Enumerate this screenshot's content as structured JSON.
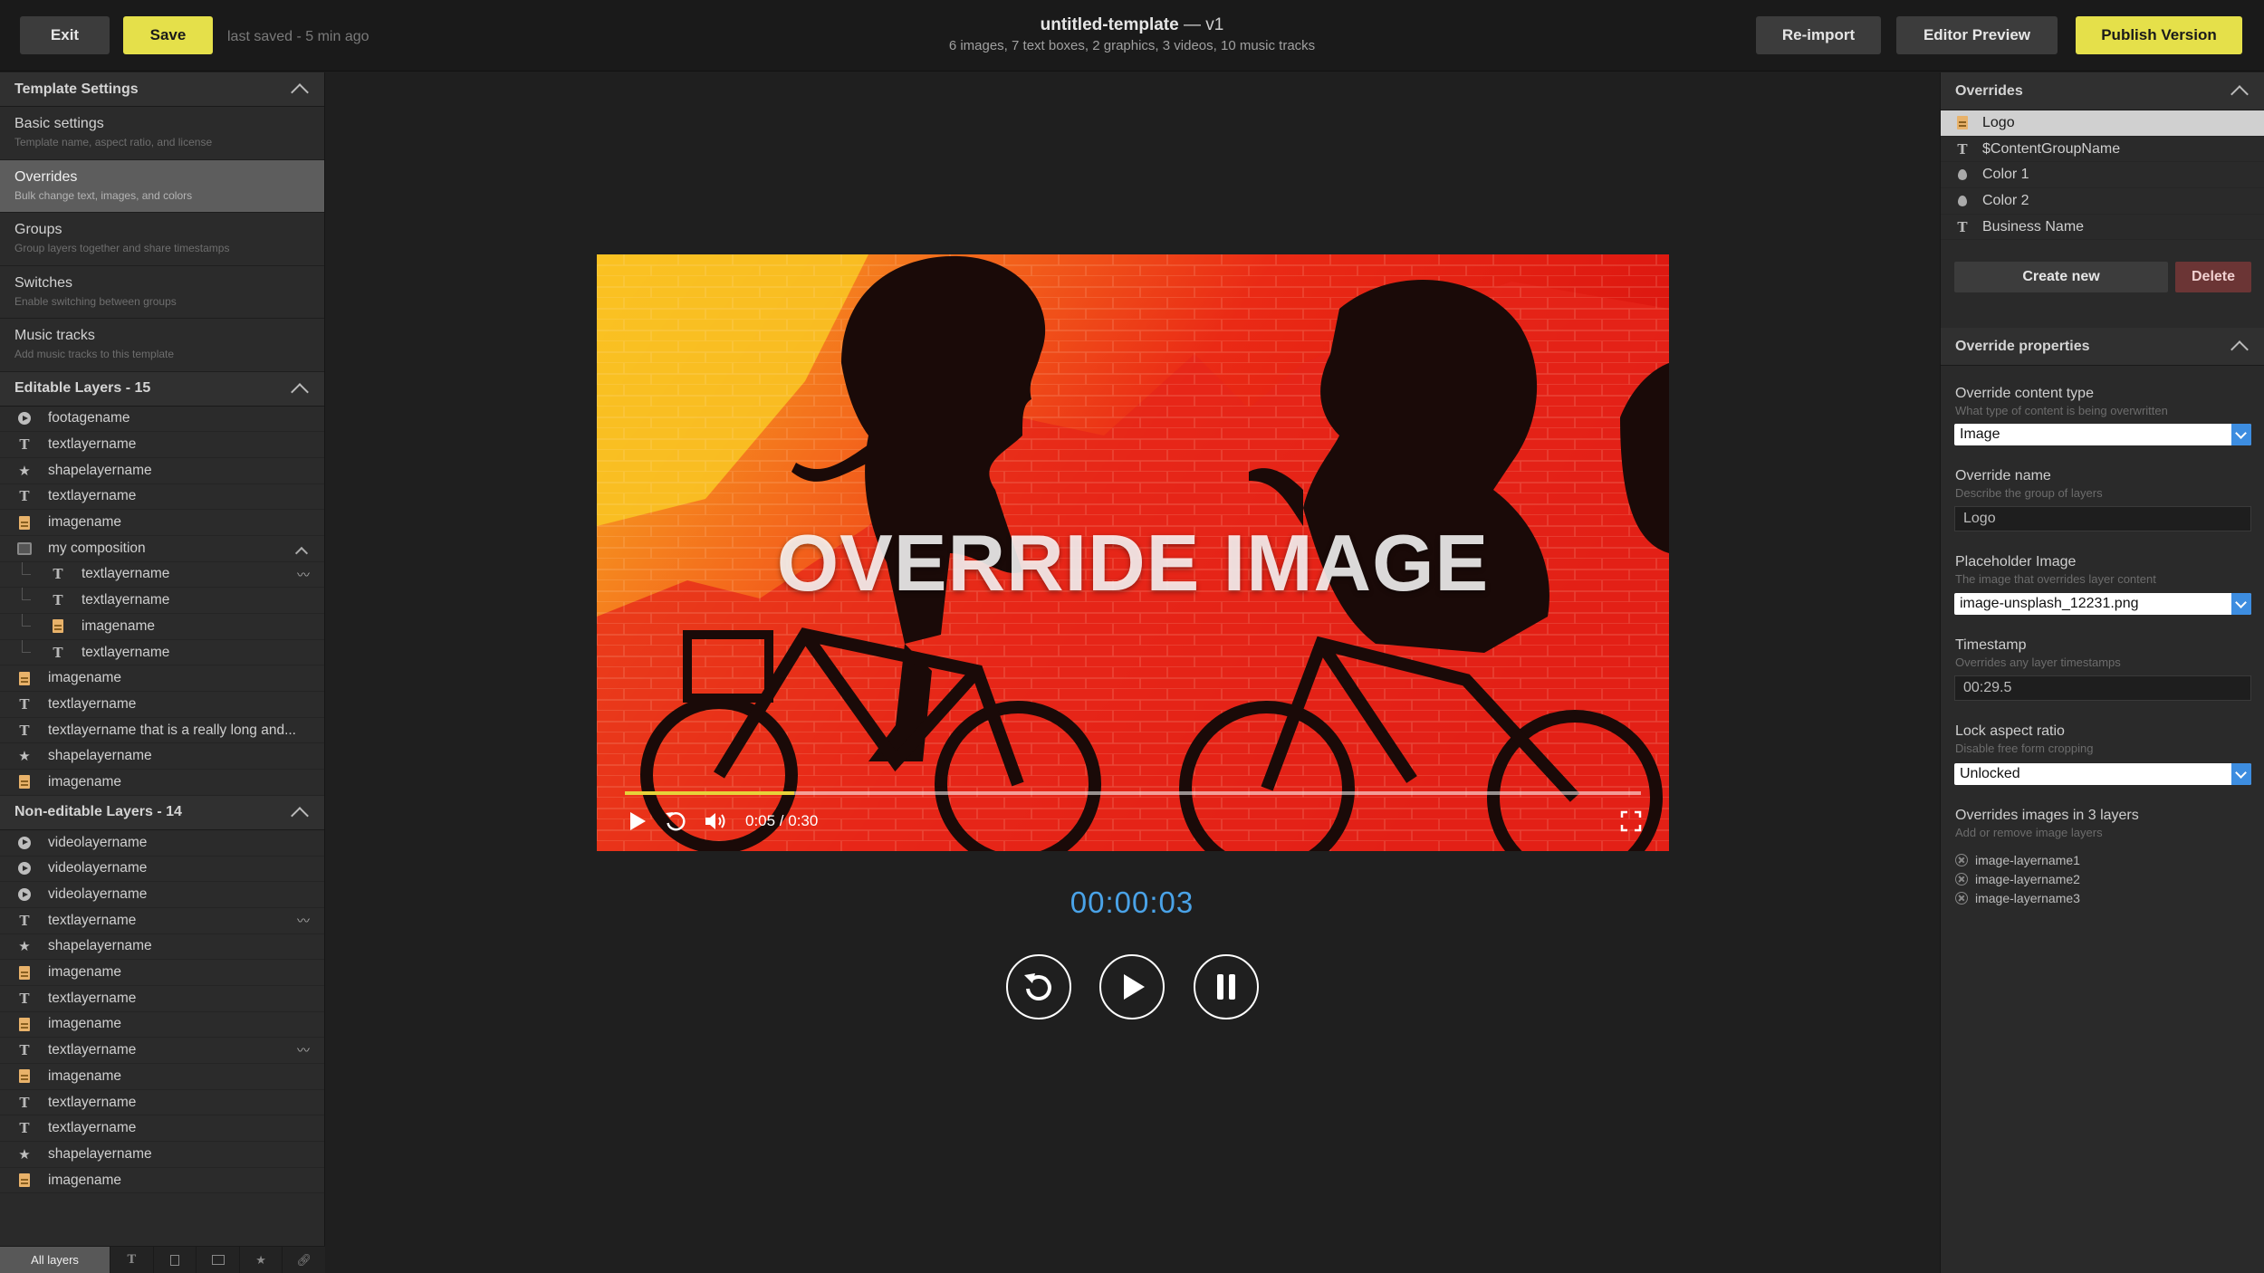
{
  "topbar": {
    "exit_label": "Exit",
    "save_label": "Save",
    "saved_status": "last saved - 5 min ago",
    "title": "untitled-template",
    "version": "— v1",
    "subtitle": "6 images, 7 text boxes, 2 graphics, 3 videos, 10 music tracks",
    "reimport_label": "Re-import",
    "editor_preview_label": "Editor Preview",
    "publish_label": "Publish Version"
  },
  "template_settings": {
    "header": "Template Settings",
    "items": [
      {
        "title": "Basic settings",
        "desc": "Template name, aspect ratio, and license",
        "active": false
      },
      {
        "title": "Overrides",
        "desc": "Bulk change text, images, and colors",
        "active": true
      },
      {
        "title": "Groups",
        "desc": "Group layers together and share timestamps",
        "active": false
      },
      {
        "title": "Switches",
        "desc": "Enable switching between groups",
        "active": false
      },
      {
        "title": "Music tracks",
        "desc": "Add music tracks to this template",
        "active": false
      }
    ]
  },
  "editable_layers": {
    "header": "Editable Layers - 15",
    "items": [
      {
        "type": "video-icon",
        "name": "footagename"
      },
      {
        "type": "text-icon",
        "name": "textlayername"
      },
      {
        "type": "star-icon",
        "name": "shapelayername"
      },
      {
        "type": "text-icon",
        "name": "textlayername"
      },
      {
        "type": "image-icon",
        "name": "imagename"
      },
      {
        "type": "composition-icon",
        "name": "my composition"
      },
      {
        "type": "text-icon",
        "name": "textlayername"
      },
      {
        "type": "text-icon",
        "name": "textlayername"
      },
      {
        "type": "image-icon",
        "name": "imagename"
      },
      {
        "type": "text-icon",
        "name": "textlayername"
      },
      {
        "type": "image-icon",
        "name": "imagename"
      },
      {
        "type": "text-icon",
        "name": "textlayername"
      },
      {
        "type": "text-icon",
        "name": "textlayername that is a really long and..."
      },
      {
        "type": "star-icon",
        "name": "shapelayername"
      },
      {
        "type": "image-icon",
        "name": "imagename"
      }
    ]
  },
  "noneditable_layers": {
    "header": "Non-editable Layers - 14",
    "items": [
      {
        "type": "video-icon",
        "name": "videolayername"
      },
      {
        "type": "video-icon",
        "name": "videolayername"
      },
      {
        "type": "video-icon",
        "name": "videolayername"
      },
      {
        "type": "text-icon",
        "name": "textlayername"
      },
      {
        "type": "star-icon",
        "name": "shapelayername"
      },
      {
        "type": "image-icon",
        "name": "imagename"
      },
      {
        "type": "text-icon",
        "name": "textlayername"
      },
      {
        "type": "image-icon",
        "name": "imagename"
      },
      {
        "type": "text-icon",
        "name": "textlayername"
      },
      {
        "type": "image-icon",
        "name": "imagename"
      },
      {
        "type": "text-icon",
        "name": "textlayername"
      },
      {
        "type": "text-icon",
        "name": "textlayername"
      },
      {
        "type": "star-icon",
        "name": "shapelayername"
      },
      {
        "type": "image-icon",
        "name": "imagename"
      }
    ]
  },
  "bottom_tabs": {
    "all_layers": "All layers"
  },
  "video": {
    "overlay_text": "OVERRIDE IMAGE",
    "time": "0:05 / 0:30",
    "progress": 0.167
  },
  "playback": {
    "timecode": "00:00:03"
  },
  "overrides": {
    "header": "Overrides",
    "items": [
      {
        "type": "image-icon",
        "name": "Logo",
        "active": true
      },
      {
        "type": "text-icon",
        "name": "$ContentGroupName",
        "active": false
      },
      {
        "type": "color-icon",
        "name": "Color 1",
        "active": false
      },
      {
        "type": "color-icon",
        "name": "Color 2",
        "active": false
      },
      {
        "type": "text-icon",
        "name": "Business Name",
        "active": false
      }
    ],
    "create_label": "Create new",
    "delete_label": "Delete"
  },
  "override_properties": {
    "header": "Override properties",
    "content_type_label": "Override content type",
    "content_type_desc": "What type of content is being overwritten",
    "content_type_value": "Image",
    "name_label": "Override name",
    "name_desc": "Describe the group of layers",
    "name_value": "Logo",
    "placeholder_label": "Placeholder Image",
    "placeholder_desc": "The image that overrides layer content",
    "placeholder_value": "image-unsplash_12231.png",
    "timestamp_label": "Timestamp",
    "timestamp_desc": "Overrides any layer timestamps",
    "timestamp_value": "00:29.5",
    "lock_label": "Lock aspect ratio",
    "lock_desc": "Disable free form cropping",
    "lock_value": "Unlocked",
    "layers_label": "Overrides images in 3 layers",
    "layers_desc": "Add or remove image layers",
    "layers": [
      "image-layername1",
      "image-layername2",
      "image-layername3"
    ]
  },
  "colors": {
    "accent_yellow": "#e5e04a",
    "timecode_blue": "#4aa3e8",
    "delete_red": "#6b3535"
  }
}
